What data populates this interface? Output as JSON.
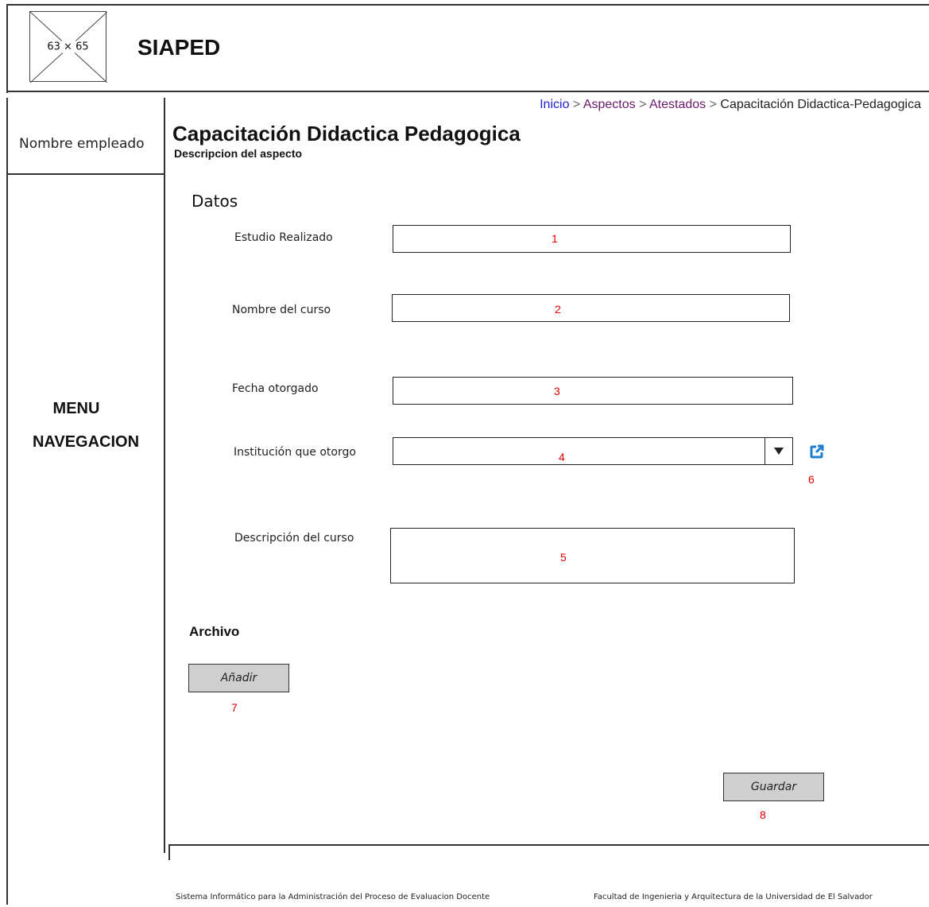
{
  "header": {
    "logo_label": "63 × 65",
    "app_title": "SIAPED"
  },
  "sidebar": {
    "user_name": "Nombre empleado",
    "menu_line1": "MENU",
    "menu_line2": "NAVEGACION"
  },
  "breadcrumb": {
    "items": [
      "Inicio",
      "Aspectos",
      "Atestados",
      "Capacitación Didactica-Pedagogica"
    ],
    "separator": ">"
  },
  "page": {
    "title": "Capacitación Didactica Pedagogica",
    "subtitle": "Descripcion del aspecto"
  },
  "form": {
    "section_title": "Datos",
    "fields": [
      {
        "label": "Estudio Realizado",
        "marker": "1"
      },
      {
        "label": "Nombre del curso",
        "marker": "2"
      },
      {
        "label": "Fecha otorgado",
        "marker": "3"
      },
      {
        "label": "Institución que otorgo",
        "marker": "4"
      },
      {
        "label": "Descripción del curso",
        "marker": "5"
      }
    ],
    "external_link_marker": "6"
  },
  "archivo": {
    "title": "Archivo",
    "add_button": "Añadir",
    "add_marker": "7"
  },
  "actions": {
    "save_button": "Guardar",
    "save_marker": "8"
  },
  "footer": {
    "left_text": "Sistema Informático para la Administración del Proceso de Evaluacion Docente",
    "right_text": "Facultad de Ingenieria y Arquitectura de la Universidad de El Salvador"
  },
  "colors": {
    "marker": "#e00000",
    "link": "#2222cc",
    "visited_link": "#6a1a6a",
    "icon": "#1e7fd0",
    "button_bg": "#cfcfcf"
  },
  "icons": {
    "external_link": "external-link-icon",
    "dropdown": "chevron-down-icon"
  }
}
